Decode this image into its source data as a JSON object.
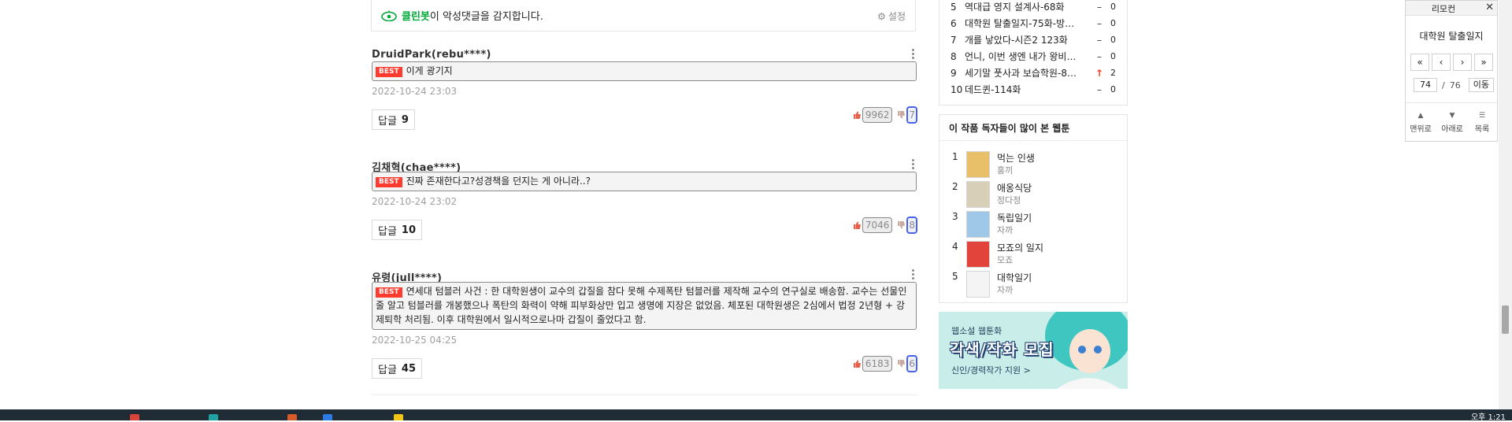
{
  "cleanbot": {
    "brand": "클린봇",
    "text": "이 악성댓글을 감지합니다.",
    "settings_label": "설정"
  },
  "comments": [
    {
      "author": "DruidPark(rebu****)",
      "best_badge": "BEST",
      "text": "이게 광기지",
      "date": "2022-10-24 23:03",
      "reply_label": "답글",
      "reply_count": "9",
      "likes": "9962",
      "dislikes": "7"
    },
    {
      "author": "김채혁(chae****)",
      "best_badge": "BEST",
      "text": "진짜 존재한다고?성경책을 던지는 게 아니라..?",
      "date": "2022-10-24 23:02",
      "reply_label": "답글",
      "reply_count": "10",
      "likes": "7046",
      "dislikes": "8"
    },
    {
      "author": "유령(jull****)",
      "best_badge": "BEST",
      "text": "연세대 텀블러 사건 : 한 대학원생이 교수의 갑질을 참다 못해 수제폭탄 텀블러를 제작해 교수의 연구실로 배송함. 교수는 선물인줄 알고 텀블러를 개봉했으나 폭탄의 화력이 약해 피부화상만 입고 생명에 지장은 없었음. 체포된 대학원생은 2심에서 법정 2년형 + 강제퇴학 처리됨. 이후 대학원에서 일시적으로나마 갑질이 줄었다고 함.",
      "date": "2022-10-25 04:25",
      "reply_label": "답글",
      "reply_count": "45",
      "likes": "6183",
      "dislikes": "6"
    }
  ],
  "ranking": [
    {
      "num": "5",
      "title": "역대급 영지 설계사-68화",
      "change": "–",
      "change_type": "same",
      "count": "0"
    },
    {
      "num": "6",
      "title": "대학원 탈출일지-75화-방…",
      "change": "–",
      "change_type": "same",
      "count": "0"
    },
    {
      "num": "7",
      "title": "개를 낳았다-시즌2 123화",
      "change": "–",
      "change_type": "same",
      "count": "0"
    },
    {
      "num": "8",
      "title": "언니, 이번 생엔 내가 왕비…",
      "change": "–",
      "change_type": "same",
      "count": "0"
    },
    {
      "num": "9",
      "title": "세기말 풋사과 보습학원-8…",
      "change": "↑",
      "change_type": "up",
      "count": "2"
    },
    {
      "num": "10",
      "title": "데드퀸-114화",
      "change": "–",
      "change_type": "same",
      "count": "0"
    }
  ],
  "readers": {
    "heading": "이 작품 독자들이 많이 본 웹툰",
    "items": [
      {
        "num": "1",
        "title": "먹는 인생",
        "author": "홍끼",
        "thumb_color": "#e8c06a"
      },
      {
        "num": "2",
        "title": "애옹식당",
        "author": "정다정",
        "thumb_color": "#d8cfb8"
      },
      {
        "num": "3",
        "title": "독립일기",
        "author": "자까",
        "thumb_color": "#9fc7e8"
      },
      {
        "num": "4",
        "title": "모죠의 일지",
        "author": "모죠",
        "thumb_color": "#e2433a"
      },
      {
        "num": "5",
        "title": "대학일기",
        "author": "자까",
        "thumb_color": "#f4f4f4"
      }
    ]
  },
  "banner": {
    "sub": "웹소설 웹툰화",
    "main": "각색/작화 모집",
    "cta": "신인/경력작가 지원 >"
  },
  "remote": {
    "title": "리모컨",
    "close": "✕",
    "work_title": "대학원 탈출일지",
    "nav_first": "«",
    "nav_prev": "‹",
    "nav_next": "›",
    "nav_last": "»",
    "current_page": "74",
    "total_pages": "76",
    "page_sep": "/",
    "go_label": "이동",
    "top_label": "맨위로",
    "bottom_label": "아래로",
    "list_label": "목록"
  },
  "taskbar": {
    "clock": "오후 1:21"
  }
}
